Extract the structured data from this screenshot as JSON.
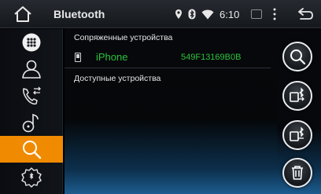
{
  "header": {
    "title": "Bluetooth",
    "time": "6:10"
  },
  "sidebar": {
    "items": [
      {
        "name": "apps-icon",
        "active": false
      },
      {
        "name": "contacts-icon",
        "active": false
      },
      {
        "name": "call-log-icon",
        "active": false
      },
      {
        "name": "music-icon",
        "active": false
      },
      {
        "name": "search-icon",
        "active": true
      },
      {
        "name": "settings-icon",
        "active": false
      }
    ],
    "active_color": "#f08a00"
  },
  "paired": {
    "section_label": "Сопряженные устройства",
    "devices": [
      {
        "name": "iPhone",
        "address": "549F13169B0B",
        "icon": "phone-icon"
      }
    ],
    "device_color": "#2cc33a"
  },
  "available": {
    "section_label": "Доступные устройства"
  },
  "actions": [
    {
      "icon": "search-icon"
    },
    {
      "icon": "bluetooth-connect-icon"
    },
    {
      "icon": "bluetooth-disconnect-icon"
    },
    {
      "icon": "trash-icon"
    }
  ]
}
